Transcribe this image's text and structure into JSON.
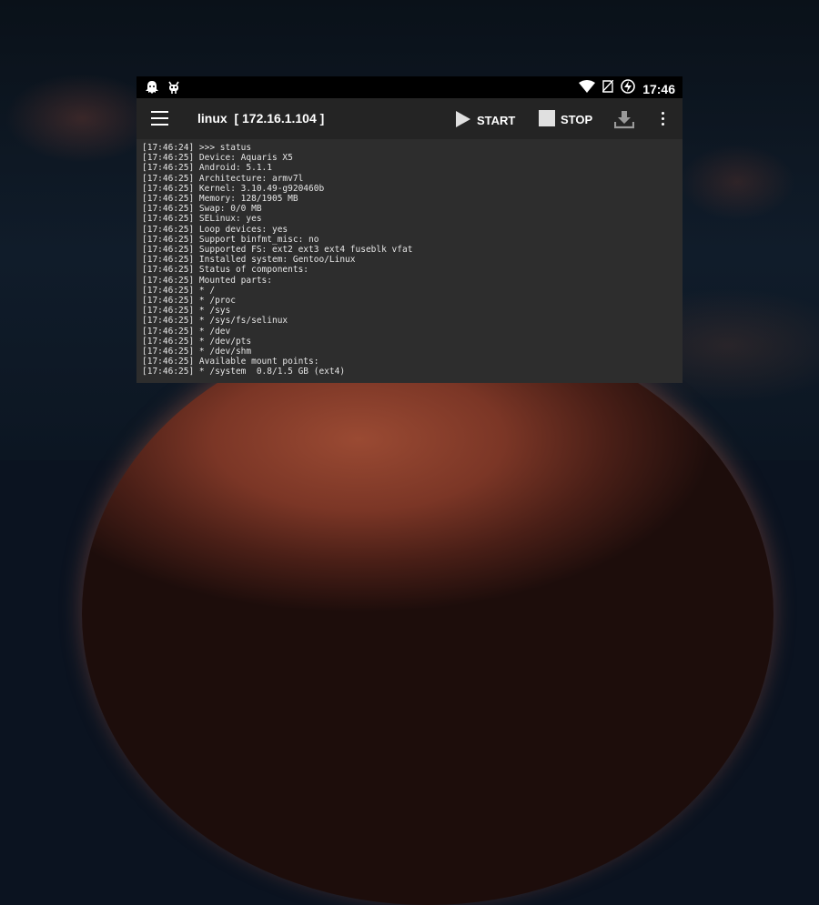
{
  "status_bar": {
    "left_icons": [
      "ghost-icon",
      "bug-icon"
    ],
    "right_icons": [
      "wifi-icon",
      "no-sim-icon",
      "battery-charging-icon"
    ],
    "time": "17:46"
  },
  "toolbar": {
    "title": "linux  [ 172.16.1.104 ]",
    "start_label": "START",
    "stop_label": "STOP",
    "icons": {
      "menu": "menu-icon",
      "start": "play-icon",
      "stop": "stop-square-icon",
      "export": "download-icon",
      "overflow": "more-vertical-icon"
    }
  },
  "terminal": {
    "lines": [
      "[17:46:24] >>> status",
      "[17:46:25] Device: Aquaris X5",
      "[17:46:25] Android: 5.1.1",
      "[17:46:25] Architecture: armv7l",
      "[17:46:25] Kernel: 3.10.49-g920460b",
      "[17:46:25] Memory: 128/1905 MB",
      "[17:46:25] Swap: 0/0 MB",
      "[17:46:25] SELinux: yes",
      "[17:46:25] Loop devices: yes",
      "[17:46:25] Support binfmt_misc: no",
      "[17:46:25] Supported FS: ext2 ext3 ext4 fuseblk vfat",
      "[17:46:25] Installed system: Gentoo/Linux",
      "[17:46:25] Status of components:",
      "[17:46:25] Mounted parts:",
      "[17:46:25] * /",
      "[17:46:25] * /proc",
      "[17:46:25] * /sys",
      "[17:46:25] * /sys/fs/selinux",
      "[17:46:25] * /dev",
      "[17:46:25] * /dev/pts",
      "[17:46:25] * /dev/shm",
      "[17:46:25] Available mount points:",
      "[17:46:25] * /system  0.8/1.5 GB (ext4)"
    ]
  },
  "colors": {
    "toolbar_bg": "#242424",
    "terminal_bg": "#2d2d2d",
    "terminal_text": "#e6e6e6",
    "status_bar_bg": "#000000"
  }
}
